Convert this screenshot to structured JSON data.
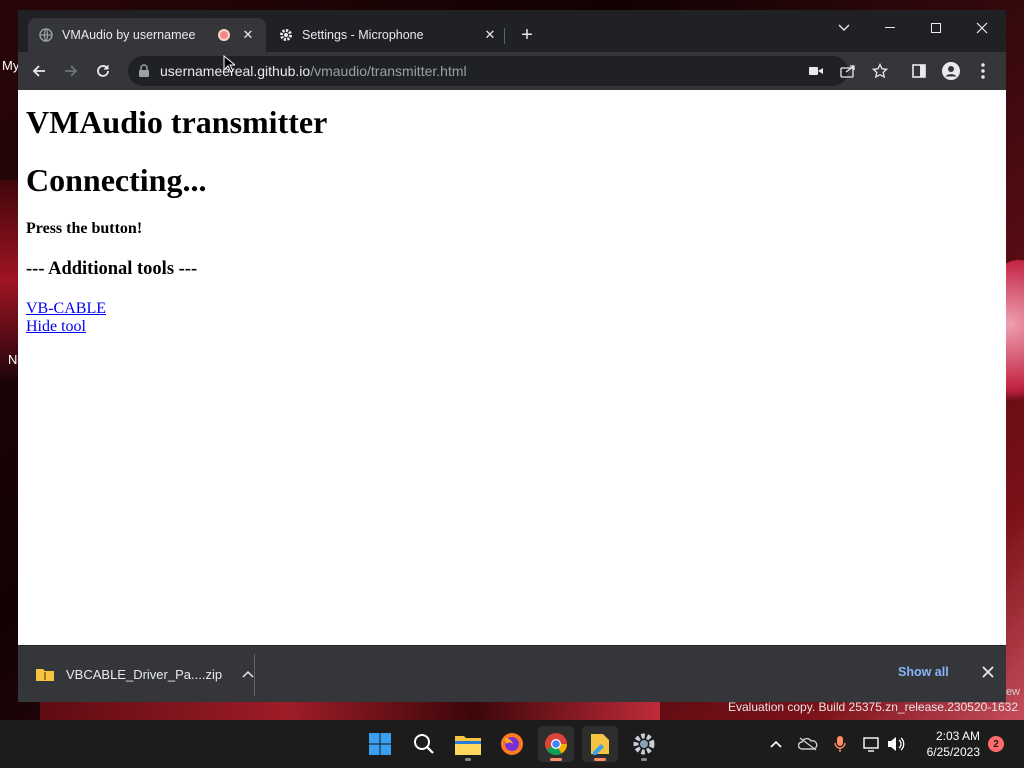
{
  "desktop": {
    "side_label_1": "My",
    "side_label_2": "N",
    "watermark_small": "ew",
    "watermark": "Evaluation copy. Build 25375.zn_release.230520-1632"
  },
  "tabs": [
    {
      "title": "VMAudio by usernamee",
      "icon": "globe-icon",
      "recording": true
    },
    {
      "title": "Settings - Microphone",
      "icon": "gear-icon"
    }
  ],
  "address_bar": {
    "host": "usernameereal.github.io",
    "path": "/vmaudio/transmitter.html"
  },
  "page": {
    "title": "VMAudio transmitter",
    "status": "Connecting...",
    "prompt": "Press the button!",
    "tools_heading": "--- Additional tools ---",
    "links": [
      "VB-CABLE",
      "Hide tool"
    ]
  },
  "download_bar": {
    "file_name": "VBCABLE_Driver_Pa....zip",
    "show_all": "Show all"
  },
  "taskbar": {
    "apps": [
      "start-icon",
      "search-icon",
      "file-explorer-icon",
      "firefox-icon",
      "chrome-icon",
      "notepad-icon",
      "settings-icon"
    ],
    "time": "2:03 AM",
    "date": "6/25/2023",
    "notification_count": "2"
  },
  "colors": {
    "link": "#0000ee",
    "recording": "#f28b82",
    "show_all": "#8ab4f8"
  }
}
